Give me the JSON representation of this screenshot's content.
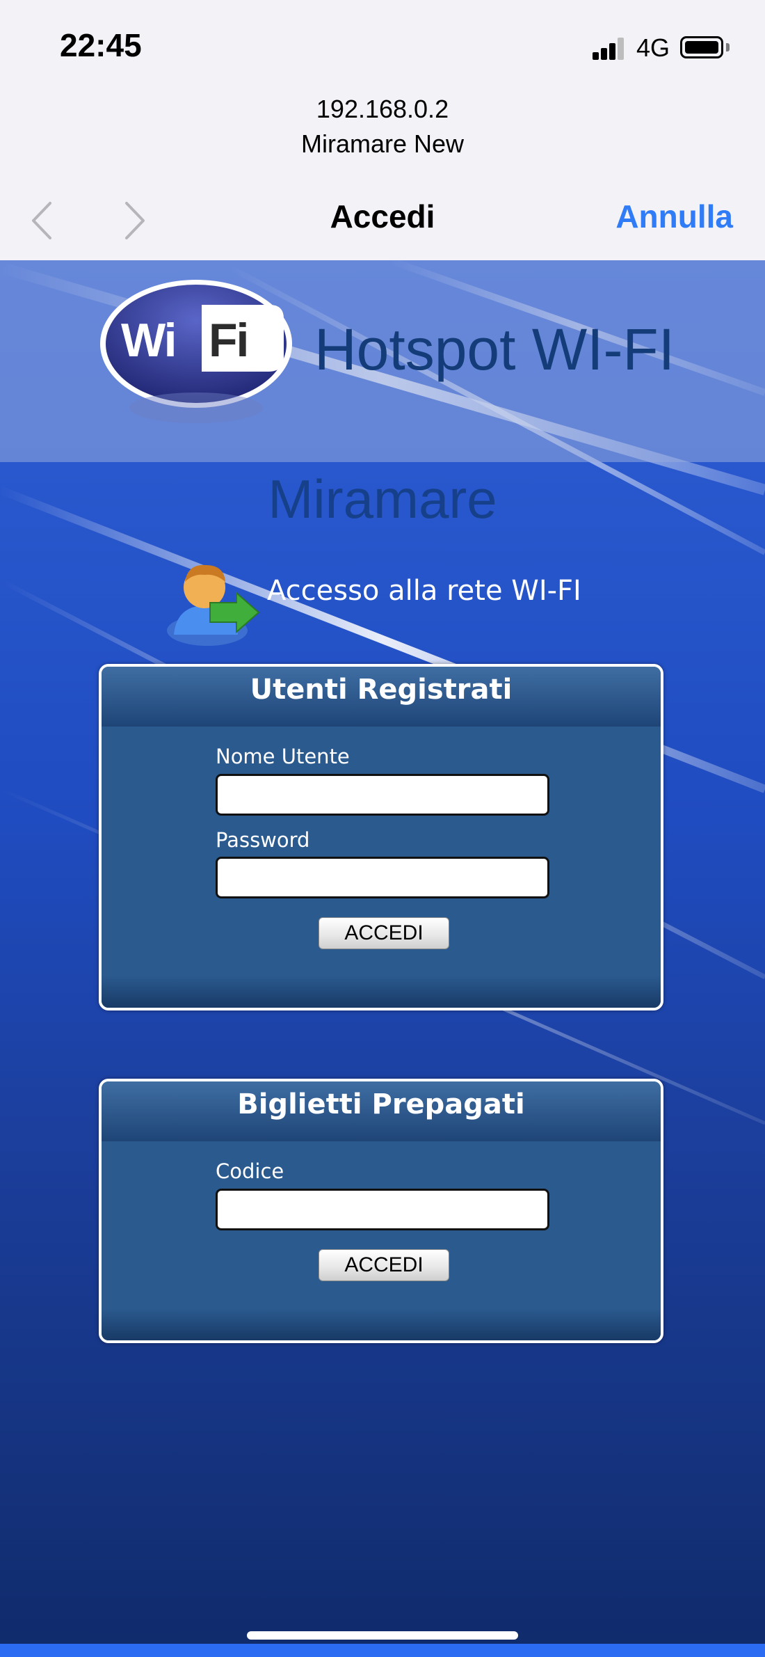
{
  "status_bar": {
    "time": "22:45",
    "network": "4G",
    "icons": [
      "signal-icon",
      "battery-icon"
    ]
  },
  "browser": {
    "url": "192.168.0.2",
    "site_name": "Miramare New",
    "title": "Accedi",
    "cancel_label": "Annulla",
    "icons": [
      "back-chevron-icon",
      "forward-chevron-icon"
    ]
  },
  "portal": {
    "logo_text": "WiFi",
    "hotspot_title": "Hotspot WI-FI",
    "location_name": "Miramare",
    "access_text": "Accesso alla rete WI-FI",
    "registered_users": {
      "title": "Utenti Registrati",
      "username_label": "Nome Utente",
      "username_value": "",
      "password_label": "Password",
      "password_value": "",
      "submit_label": "ACCEDI"
    },
    "prepaid_tickets": {
      "title": "Biglietti Prepagati",
      "code_label": "Codice",
      "code_value": "",
      "submit_label": "ACCEDI"
    }
  },
  "colors": {
    "accent": "#2f7cf6",
    "portal_blue": "#1f4cc0",
    "panel_blue": "#2b5a8f",
    "title_blue": "#143c78"
  }
}
